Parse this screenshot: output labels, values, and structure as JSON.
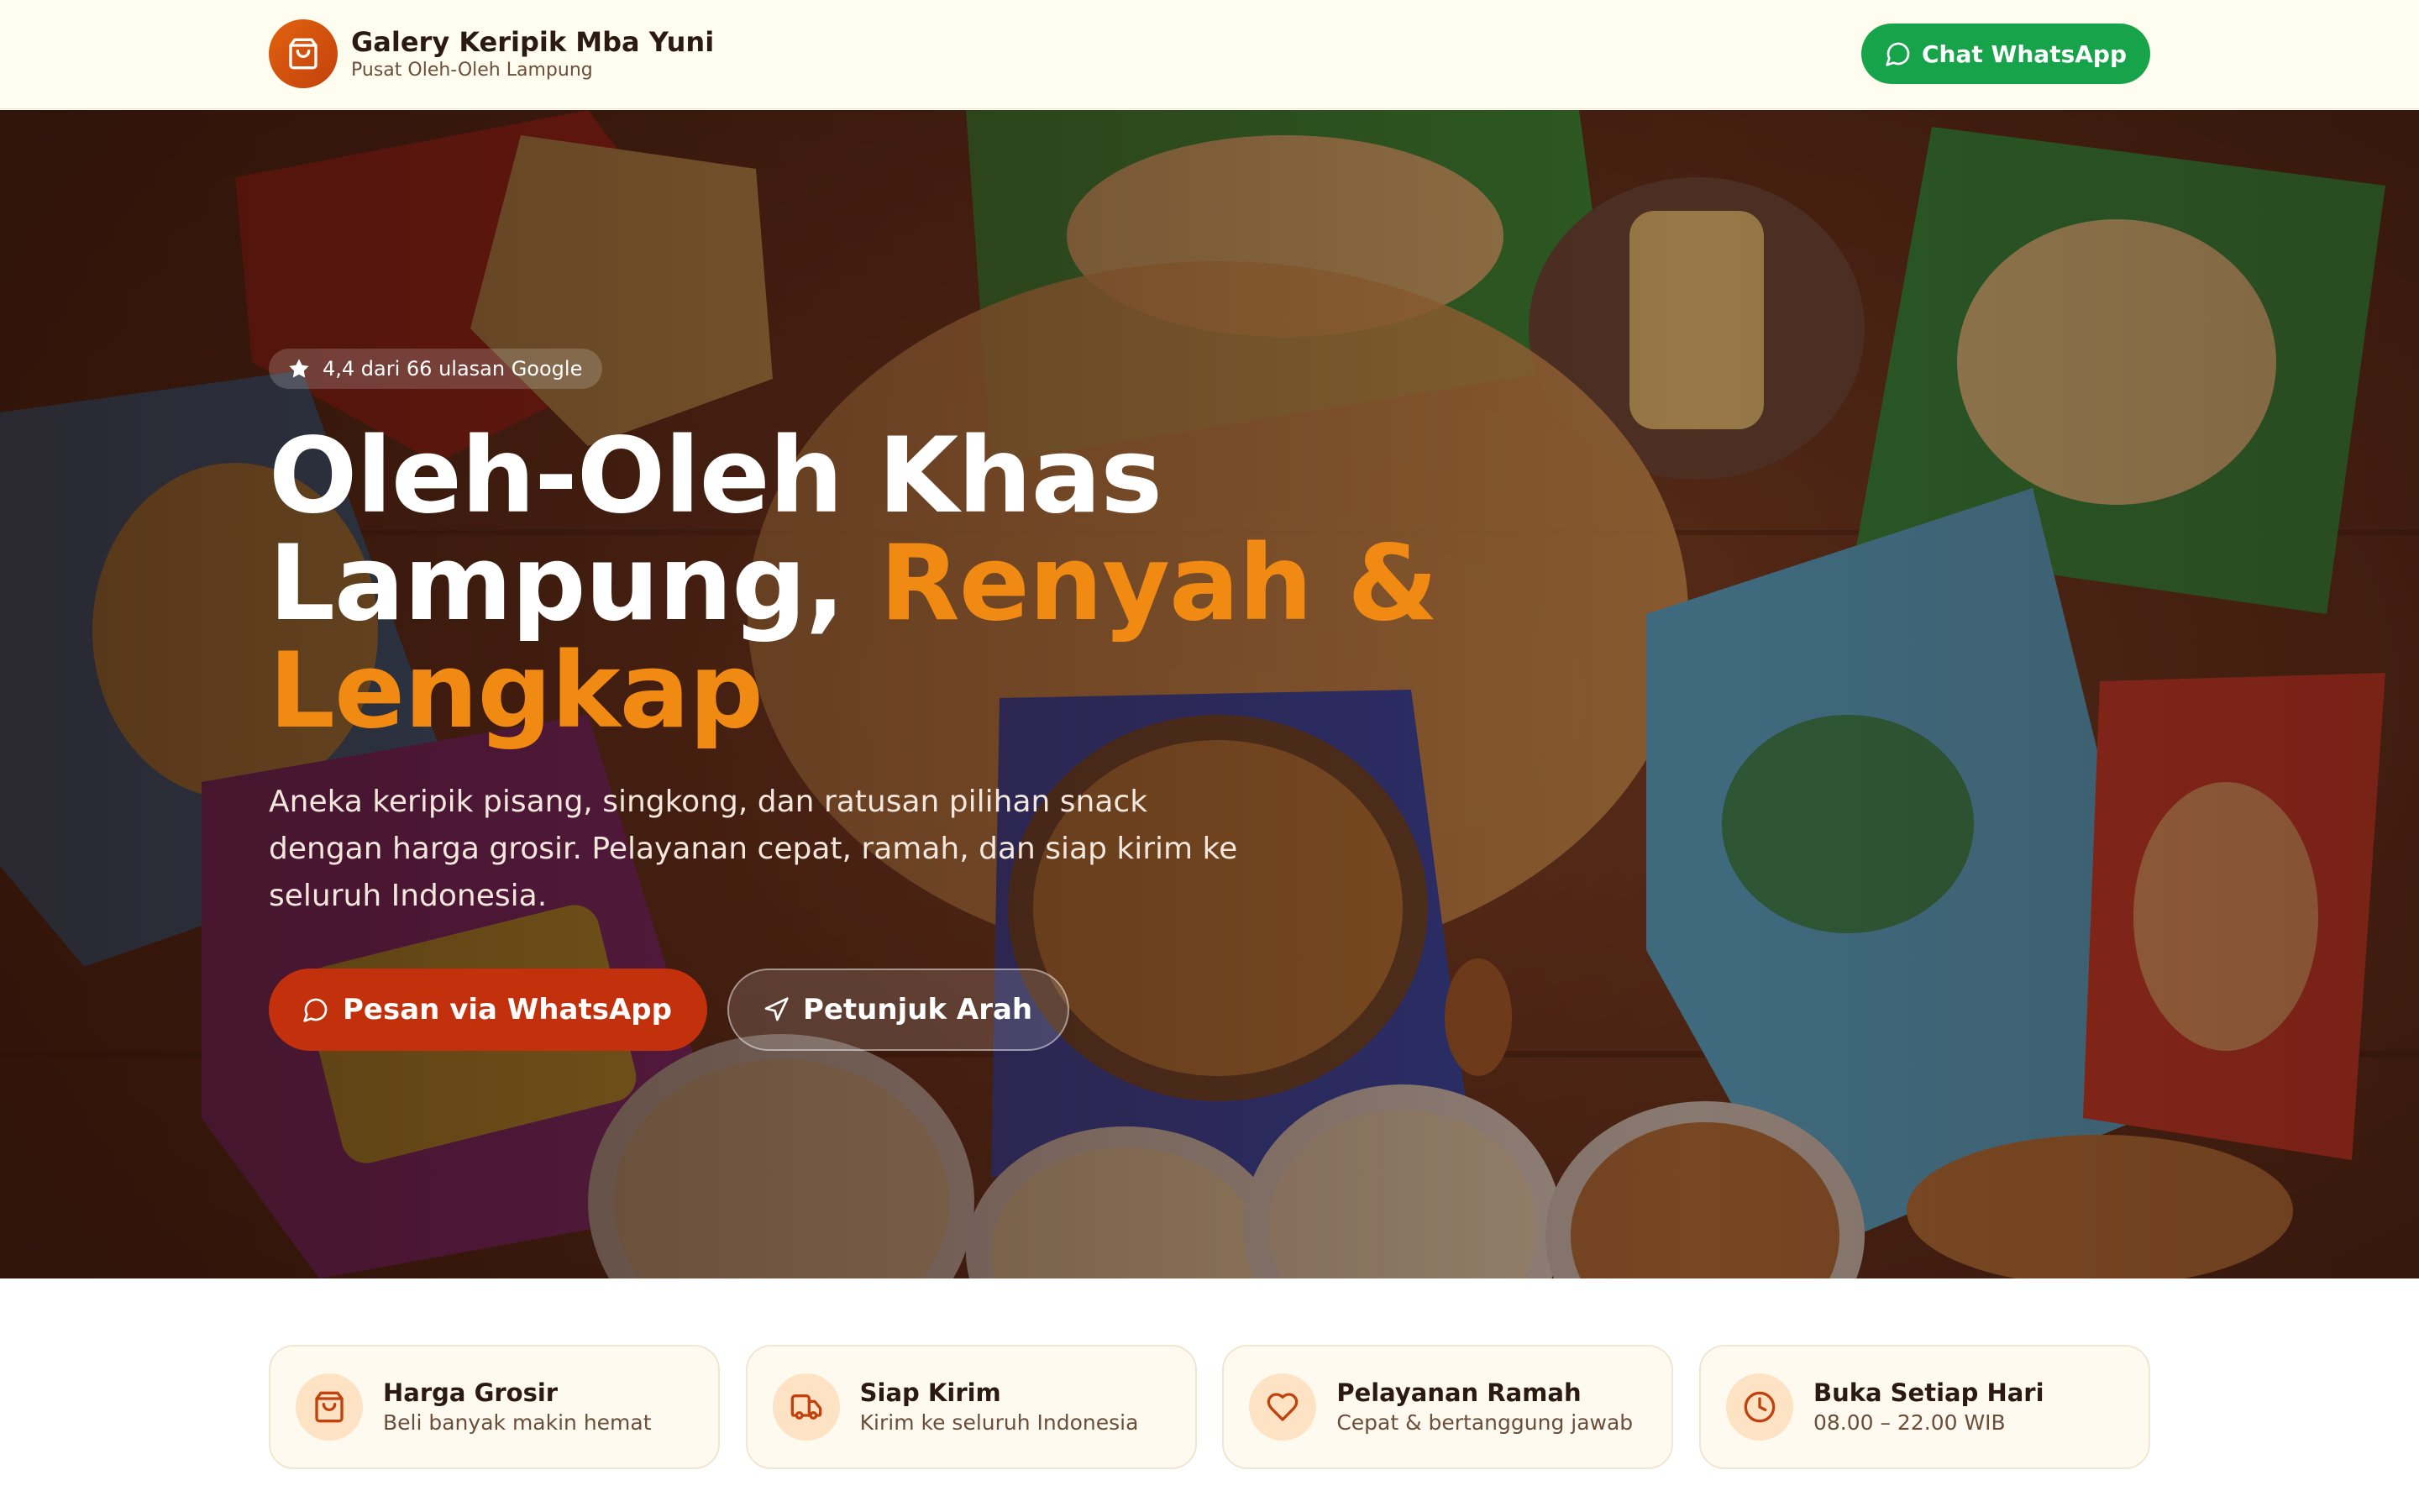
{
  "header": {
    "brand_name": "Galery Keripik Mba Yuni",
    "brand_tagline": "Pusat Oleh-Oleh Lampung",
    "chat_button": "Chat WhatsApp"
  },
  "hero": {
    "rating": "4,4 dari 66 ulasan Google",
    "headline_line1": "Oleh-Oleh Khas",
    "headline_line2": "Lampung, ",
    "headline_accent": "Renyah &",
    "headline_line3": "Lengkap",
    "description": "Aneka keripik pisang, singkong, dan ratusan pilihan snack dengan harga grosir. Pelayanan cepat, ramah, dan siap kirim ke seluruh Indonesia.",
    "primary_cta": "Pesan via WhatsApp",
    "secondary_cta": "Petunjuk Arah"
  },
  "features": [
    {
      "icon": "shopping-bag-icon",
      "title": "Harga Grosir",
      "subtitle": "Beli banyak makin hemat"
    },
    {
      "icon": "truck-icon",
      "title": "Siap Kirim",
      "subtitle": "Kirim ke seluruh Indonesia"
    },
    {
      "icon": "heart-icon",
      "title": "Pelayanan Ramah",
      "subtitle": "Cepat & bertanggung jawab"
    },
    {
      "icon": "clock-icon",
      "title": "Buka Setiap Hari",
      "subtitle": "08.00 – 22.00 WIB"
    }
  ],
  "colors": {
    "accent_orange": "#f08a12",
    "primary_red": "#c2300c",
    "whatsapp_green": "#16a34a",
    "header_bg": "#fffcf0"
  }
}
